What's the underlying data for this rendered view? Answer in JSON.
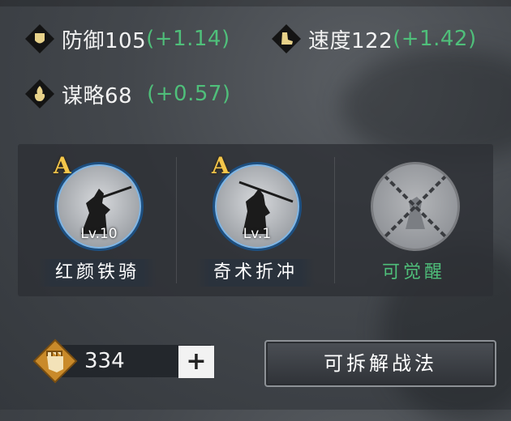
{
  "stats": {
    "defense": {
      "label": "防御105",
      "bonus": "(+1.14)"
    },
    "speed": {
      "label": "速度122",
      "bonus": "(+1.42)"
    },
    "strategy": {
      "label": "谋略68",
      "bonus": "(+0.57)"
    }
  },
  "skills": [
    {
      "grade": "A",
      "level": "Lv.10",
      "name": "红颜铁骑"
    },
    {
      "grade": "A",
      "level": "Lv.1",
      "name": "奇术折冲"
    },
    {
      "name": "可觉醒"
    }
  ],
  "currency": {
    "value": "334",
    "plus": "+"
  },
  "actions": {
    "disassemble_label": "可拆解战法"
  },
  "colors": {
    "bonus_green": "#4fbf7a",
    "grade_gold": "#f4c64a",
    "frame_blue": "#1d4f80"
  },
  "icons": [
    "shield-icon",
    "boot-icon",
    "flame-icon",
    "fist-icon",
    "plus-icon"
  ]
}
